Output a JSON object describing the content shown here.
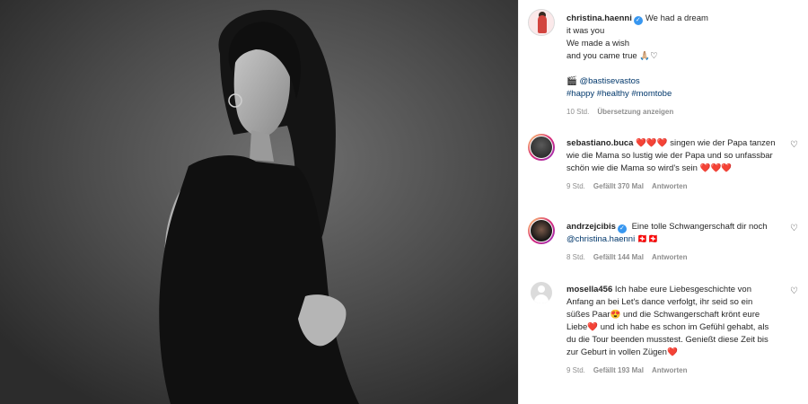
{
  "caption": {
    "username": "christina.haenni",
    "lines": [
      "We had a dream",
      "it was you",
      "We made a wish",
      "and you came true 🙏🏼♡"
    ],
    "credit_icon": "🎬",
    "credit_handle": "@bastisevastos",
    "hashtags": "#happy #healthy #momtobe",
    "time": "10 Std.",
    "translate": "Übersetzung anzeigen"
  },
  "comments": [
    {
      "username": "sebastiano.buca",
      "verified": false,
      "pre": "❤️❤️❤️",
      "text": "singen wie der Papa tanzen wie die Mama so lustig wie der Papa und so unfassbar schön wie die Mama so wird's sein",
      "post": "❤️❤️❤️",
      "time": "9 Std.",
      "likes": "Gefällt 370 Mal",
      "reply": "Antworten"
    },
    {
      "username": "andrzejcibis",
      "verified": true,
      "text": "Eine tolle Schwangerschaft dir noch",
      "mention": "@christina.haenni",
      "tail": "🇨🇭🇨🇭",
      "time": "8 Std.",
      "likes": "Gefällt 144 Mal",
      "reply": "Antworten"
    },
    {
      "username": "mosella456",
      "verified": false,
      "text": "Ich habe eure Liebesgeschichte von Anfang an bei Let's dance verfolgt, ihr seid so ein süßes Paar😍 und die Schwangerschaft krönt eure Liebe❤️ und ich habe es schon im Gefühl gehabt, als du die Tour beenden musstest. Genießt diese Zeit bis zur Geburt in vollen Zügen❤️",
      "time": "9 Std.",
      "likes": "Gefällt 193 Mal",
      "reply": "Antworten"
    }
  ],
  "icons": {
    "verified": "✓",
    "like": "♡"
  },
  "colors": {
    "link": "#00376b",
    "verified": "#3897f0",
    "meta": "#8e8e8e",
    "heart": "#ed1c24"
  }
}
